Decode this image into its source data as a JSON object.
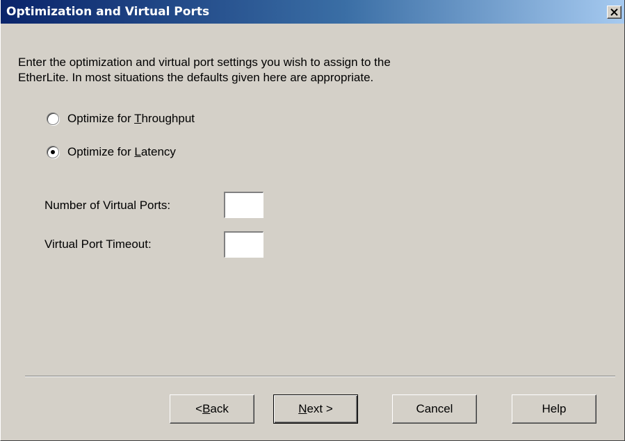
{
  "window": {
    "title": "Optimization and  Virtual Ports",
    "close_label": "close"
  },
  "description": "Enter the optimization and virtual port settings you wish to assign to the\nEtherLite.  In most situations the defaults given here are appropriate.",
  "radios": [
    {
      "pre": "Optimize for ",
      "accel": "T",
      "post": "hroughput",
      "checked": false
    },
    {
      "pre": "Optimize for ",
      "accel": "L",
      "post": "atency",
      "checked": true
    }
  ],
  "fields": {
    "virtual_ports": {
      "label": "Number of Virtual Ports:",
      "value": ""
    },
    "timeout": {
      "label": "Virtual Port Timeout:",
      "value": ""
    }
  },
  "buttons": {
    "back": {
      "pre": "< ",
      "accel": "B",
      "post": "ack"
    },
    "next": {
      "pre": "",
      "accel": "N",
      "post": "ext >"
    },
    "cancel": {
      "label": "Cancel"
    },
    "help": {
      "label": "Help"
    }
  }
}
